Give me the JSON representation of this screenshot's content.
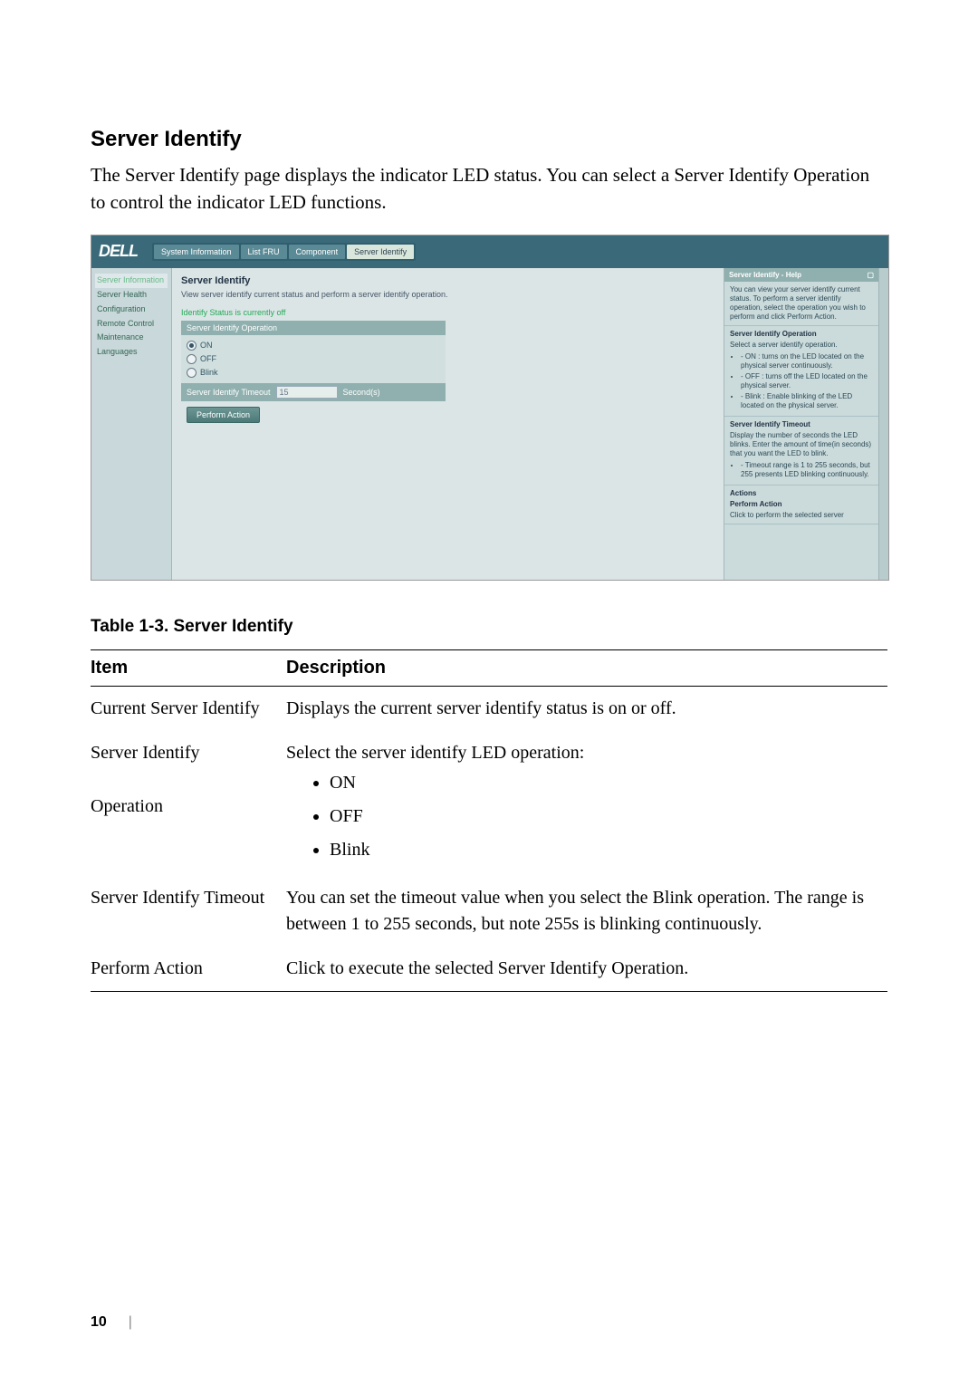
{
  "section_title": "Server Identify",
  "intro": "The Server Identify page displays the indicator LED status. You can select a Server Identify Operation to control the indicator LED functions.",
  "screenshot": {
    "logo": "DELL",
    "tabs": [
      {
        "label": "System Information",
        "active": false
      },
      {
        "label": "List FRU",
        "active": false
      },
      {
        "label": "Component",
        "active": false
      },
      {
        "label": "Server Identify",
        "active": true
      }
    ],
    "sidebar": [
      "Server Information",
      "Server Health",
      "Configuration",
      "Remote Control",
      "Maintenance",
      "Languages"
    ],
    "main": {
      "heading": "Server Identify",
      "description": "View server identify current status and perform a server identify operation.",
      "status": "Identify Status is currently off",
      "operation_header": "Server Identify Operation",
      "options": [
        {
          "label": "ON",
          "selected": true
        },
        {
          "label": "OFF",
          "selected": false
        },
        {
          "label": "Blink",
          "selected": false
        }
      ],
      "timeout_header": "Server Identify Timeout",
      "timeout_value": "15",
      "timeout_unit": "Second(s)",
      "action_button": "Perform Action"
    },
    "help": {
      "title": "Server Identify - Help",
      "intro": "You can view your server identify current status. To perform a server identify operation, select the operation you wish to perform and click Perform Action.",
      "op_title": "Server Identify Operation",
      "op_desc": "Select a server identify operation.",
      "op_bullets": [
        "- ON : turns on the LED located on the physical server continuously.",
        "- OFF : turns off the LED located on the physical server.",
        "- Blink : Enable blinking of the LED located on the physical server."
      ],
      "to_title": "Server Identify Timeout",
      "to_desc": "Display the number of seconds the LED blinks. Enter the amount of time(in seconds) that you want the LED to blink.",
      "to_bullets": [
        "- Timeout range is 1 to 255 seconds, but 255 presents LED blinking continuously."
      ],
      "actions_title": "Actions",
      "actions_sub": "Perform Action",
      "actions_desc": "Click to perform the selected server"
    }
  },
  "table_caption": "Table 1-3.   Server Identify",
  "table": {
    "headers": [
      "Item",
      "Description"
    ],
    "rows": [
      {
        "item": "Current Server Identify",
        "desc": "Displays the current server identify status is on or off."
      },
      {
        "item_a": "Server Identify",
        "item_b": "Operation",
        "desc_intro": "Select the server identify LED operation:",
        "opts": [
          "ON",
          "OFF",
          "Blink"
        ]
      },
      {
        "item": "Server Identify Timeout",
        "desc": "You can set the timeout value when you select the Blink operation. The range is between 1 to 255 seconds, but note 255s is blinking continuously."
      },
      {
        "item": "Perform Action",
        "desc": "Click to execute the selected Server Identify Operation."
      }
    ]
  },
  "page_number": "10"
}
